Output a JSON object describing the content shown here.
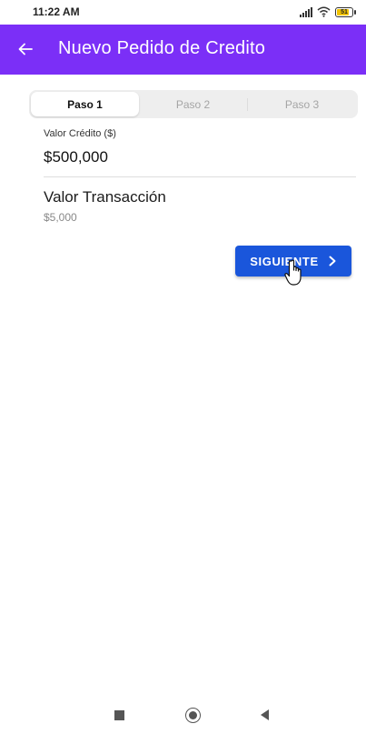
{
  "status_bar": {
    "time": "11:22 AM",
    "battery_level": "51",
    "icons": [
      "signal-icon",
      "wifi-icon",
      "battery-icon"
    ]
  },
  "app_bar": {
    "title": "Nuevo Pedido de Credito",
    "back_icon": "arrow-left-icon",
    "background_color": "#7b2ff7"
  },
  "stepper": {
    "steps": [
      {
        "label": "Paso 1",
        "active": true
      },
      {
        "label": "Paso 2",
        "active": false
      },
      {
        "label": "Paso 3",
        "active": false
      }
    ]
  },
  "form": {
    "credit_label": "Valor Crédito ($)",
    "credit_value": "$500,000",
    "transaction_title": "Valor Transacción",
    "transaction_value": "$5,000"
  },
  "actions": {
    "next_label": "SIGUIENTE",
    "next_icon": "chevron-right-icon",
    "next_color": "#1a56db"
  },
  "nav_bar": {
    "icons": [
      "recents-square-icon",
      "home-circle-icon",
      "back-triangle-icon"
    ]
  }
}
